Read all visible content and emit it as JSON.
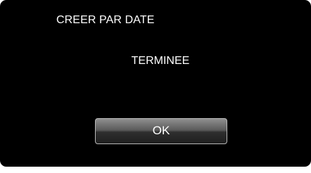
{
  "dialog": {
    "title": "CREER PAR DATE",
    "message": "TERMINEE",
    "ok_label": "OK"
  },
  "colors": {
    "background": "#000000",
    "text": "#ffffff",
    "button_border": "#b9b9b9"
  }
}
